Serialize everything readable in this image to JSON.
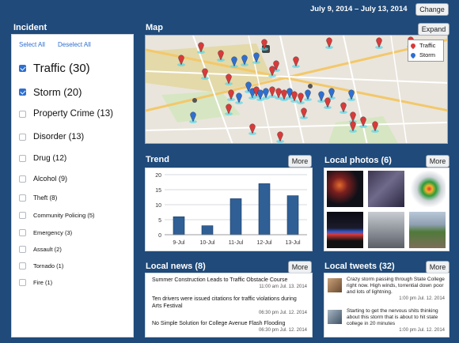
{
  "date_range": "July 9, 2014 – July 13, 2014",
  "change_label": "Change",
  "incident": {
    "title": "Incident",
    "select_all": "Select All",
    "deselect_all": "Deselect All",
    "items": [
      {
        "label": "Traffic (30)",
        "checked": true
      },
      {
        "label": "Storm (20)",
        "checked": true
      },
      {
        "label": "Property Crime (13)",
        "checked": false
      },
      {
        "label": "Disorder (13)",
        "checked": false
      },
      {
        "label": "Drug (12)",
        "checked": false
      },
      {
        "label": "Alcohol (9)",
        "checked": false
      },
      {
        "label": "Theft (8)",
        "checked": false
      },
      {
        "label": "Community Policing (5)",
        "checked": false
      },
      {
        "label": "Emergency (3)",
        "checked": false
      },
      {
        "label": "Assault (2)",
        "checked": false
      },
      {
        "label": "Tornado (1)",
        "checked": false
      },
      {
        "label": "Fire (1)",
        "checked": false
      }
    ]
  },
  "map": {
    "title": "Map",
    "expand_label": "Expand",
    "legend": [
      {
        "label": "Traffic",
        "color": "#d93a3a"
      },
      {
        "label": "Storm",
        "color": "#2e6fd1"
      }
    ]
  },
  "trend": {
    "title": "Trend",
    "more_label": "More"
  },
  "chart_data": {
    "type": "bar",
    "categories": [
      "9-Jul",
      "10-Jul",
      "11-Jul",
      "12-Jul",
      "13-Jul"
    ],
    "values": [
      6,
      3,
      12,
      17,
      13
    ],
    "ylim": [
      0,
      20
    ],
    "yticks": [
      0,
      5,
      10,
      15,
      20
    ],
    "grid": true,
    "color": "#2f5f95"
  },
  "photos": {
    "title": "Local photos (6)",
    "more_label": "More"
  },
  "news": {
    "title": "Local news (8)",
    "more_label": "More",
    "items": [
      {
        "title": "Summer Construction Leads to Traffic Obstacle Course",
        "time": "11:00 am Jul. 13. 2014"
      },
      {
        "title": "Ten drivers were issued citations for traffic violations during Arts Festival",
        "time": "06:30 pm Jul. 12. 2014"
      },
      {
        "title": "No Simple Solution for College Avenue Flash Flooding",
        "time": "06:30 pm Jul. 12. 2014"
      }
    ]
  },
  "tweets": {
    "title": "Local tweets (32)",
    "more_label": "More",
    "items": [
      {
        "text": "Crazy storm passing through State College right now. High winds, torrential down poor and lots of lightning.",
        "time": "1:00 pm Jul. 12. 2014"
      },
      {
        "text": "Starting to get the nervous shits thinking about this storm that is about to hit state college in 20 minutes",
        "time": "1:00 pm Jul. 12. 2014"
      }
    ]
  }
}
